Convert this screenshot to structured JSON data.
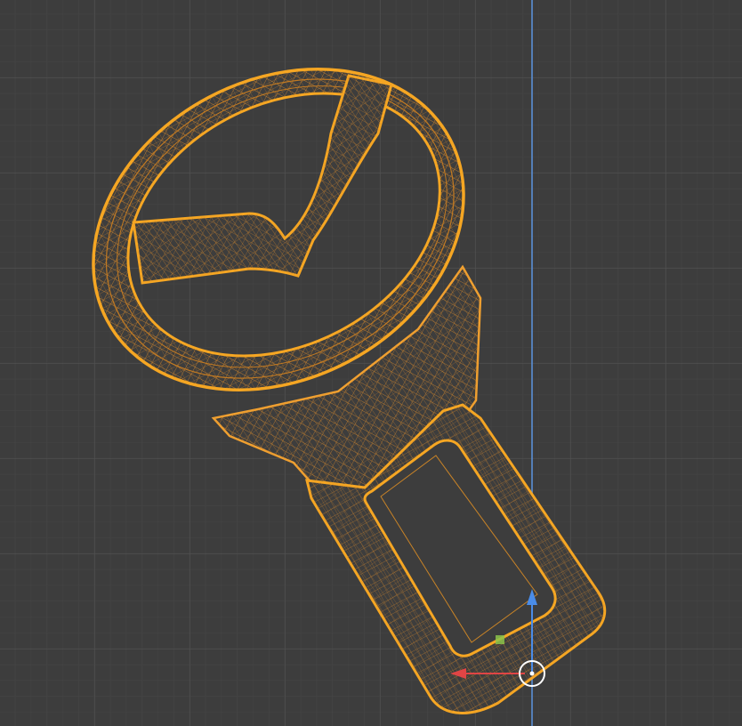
{
  "viewport": {
    "background": "#3d3d3d",
    "grid_minor_color": "#474747",
    "grid_major_color": "#525252",
    "z_axis_color": "#5a8fd6",
    "selection_outline_color": "#f5a623",
    "wire_color": "#e08f2a",
    "gizmo": {
      "x_axis_color": "#e04545",
      "z_axis_color": "#4a8ce8",
      "center_color": "#ffffff",
      "y_plane_handle_color": "#8bc34a"
    }
  },
  "object": {
    "description_icon": "seatbelt-buckle-mesh-icon",
    "selected": true,
    "display_mode": "wireframe"
  },
  "tools": {
    "transform_gizmo_icon": "move-gizmo-icon",
    "origin_icon": "object-origin-icon"
  }
}
